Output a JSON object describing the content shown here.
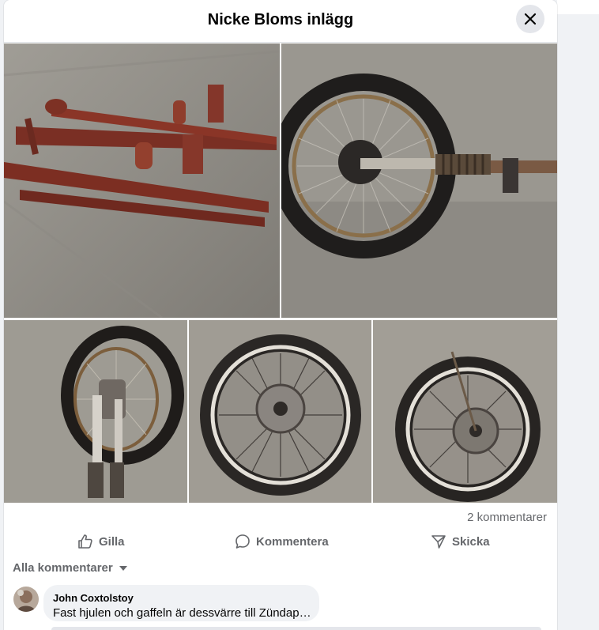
{
  "dialog": {
    "title": "Nicke Bloms inlägg"
  },
  "photos": [
    {
      "subject": "rusty-red-frame"
    },
    {
      "subject": "front-wheel-with-fork"
    },
    {
      "subject": "wheel-with-fork-legs"
    },
    {
      "subject": "wheel-hub-side"
    },
    {
      "subject": "wheel-hub-other-side"
    }
  ],
  "stats": {
    "comments_count": "2 kommentarer"
  },
  "actions": {
    "like": "Gilla",
    "comment": "Kommentera",
    "share": "Skicka"
  },
  "comments_filter": {
    "label": "Alla kommentarer"
  },
  "comments": [
    {
      "author": "John Coxtolstoy",
      "text": "Fast hjulen och gaffeln är dessvärre till Zündapp..."
    }
  ],
  "colors": {
    "text_primary": "#050505",
    "text_secondary": "#65676b",
    "divider": "#dadde1",
    "surface": "#f0f2f5"
  }
}
